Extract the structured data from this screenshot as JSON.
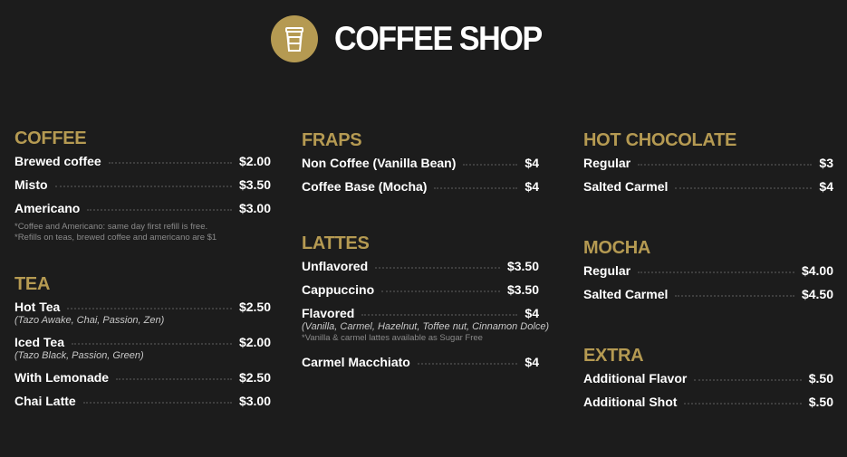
{
  "header": {
    "title": "COFFEE SHOP",
    "logo_icon": "coffee-cup-icon"
  },
  "colors": {
    "background": "#1c1c1c",
    "accent": "#b59a52",
    "text": "#ffffff"
  },
  "coffee": {
    "title": "COFFEE",
    "items": [
      {
        "name": "Brewed coffee",
        "price": "$2.00"
      },
      {
        "name": "Misto",
        "price": "$3.50"
      },
      {
        "name": "Americano",
        "price": "$3.00"
      }
    ],
    "notes": [
      "*Coffee and Americano: same day first refill is free.",
      "*Refills on teas, brewed coffee and americano are $1"
    ]
  },
  "tea": {
    "title": "TEA",
    "items": [
      {
        "name": "Hot Tea",
        "price": "$2.50",
        "sub": "(Tazo Awake, Chai, Passion, Zen)"
      },
      {
        "name": "Iced Tea",
        "price": "$2.00",
        "sub": "(Tazo Black, Passion, Green)"
      },
      {
        "name": "With Lemonade",
        "price": "$2.50"
      },
      {
        "name": "Chai Latte",
        "price": "$3.00"
      }
    ]
  },
  "fraps": {
    "title": "FRAPS",
    "items": [
      {
        "name": "Non Coffee (Vanilla Bean)",
        "price": "$4"
      },
      {
        "name": "Coffee Base (Mocha)",
        "price": "$4"
      }
    ]
  },
  "lattes": {
    "title": "LATTES",
    "items": [
      {
        "name": "Unflavored",
        "price": "$3.50"
      },
      {
        "name": "Cappuccino",
        "price": "$3.50"
      },
      {
        "name": "Flavored",
        "price": "$4",
        "sub": "(Vanilla, Carmel, Hazelnut, Toffee nut, Cinnamon Dolce)",
        "note": "*Vanilla & carmel lattes available as Sugar Free"
      },
      {
        "name": "Carmel Macchiato",
        "price": "$4"
      }
    ]
  },
  "hot_chocolate": {
    "title": "HOT CHOCOLATE",
    "items": [
      {
        "name": "Regular",
        "price": "$3"
      },
      {
        "name": "Salted Carmel",
        "price": "$4"
      }
    ]
  },
  "mocha": {
    "title": "MOCHA",
    "items": [
      {
        "name": "Regular",
        "price": "$4.00"
      },
      {
        "name": "Salted Carmel",
        "price": "$4.50"
      }
    ]
  },
  "extra": {
    "title": "EXTRA",
    "items": [
      {
        "name": "Additional Flavor",
        "price": "$.50"
      },
      {
        "name": "Additional Shot",
        "price": "$.50"
      }
    ]
  }
}
